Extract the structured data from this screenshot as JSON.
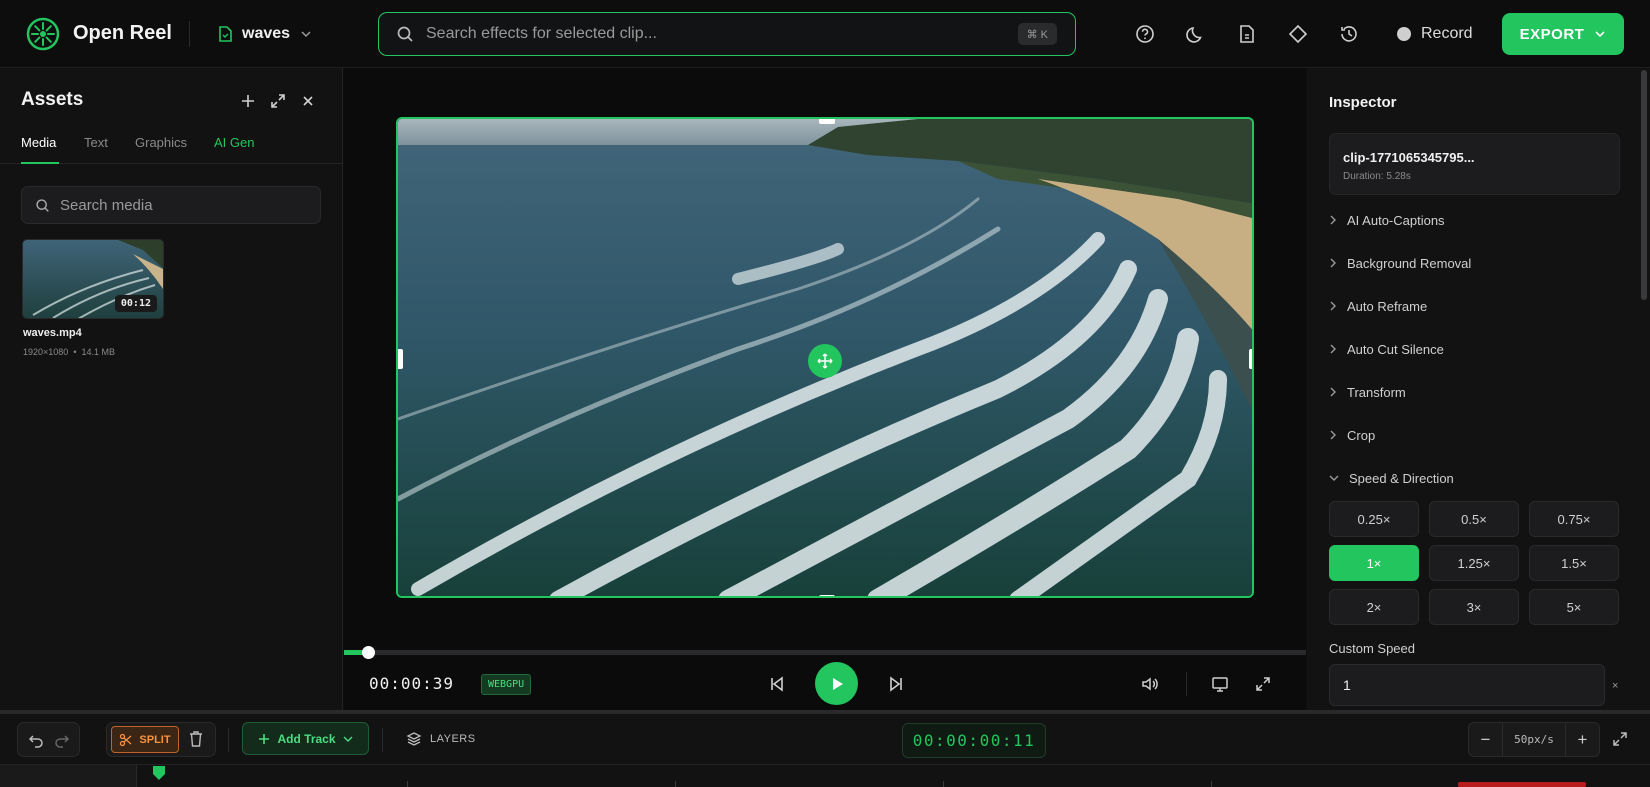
{
  "topbar": {
    "app_title": "Open Reel",
    "project_name": "waves",
    "search_placeholder": "Search effects for selected clip...",
    "search_shortcut": "⌘ K",
    "record_label": "Record",
    "export_label": "EXPORT",
    "icons": [
      "help-icon",
      "moon-icon",
      "document-icon",
      "diamond-icon",
      "history-icon"
    ]
  },
  "assets": {
    "title": "Assets",
    "tabs": [
      "Media",
      "Text",
      "Graphics",
      "AI Gen"
    ],
    "active_tab": "Media",
    "search_placeholder": "Search media",
    "media": [
      {
        "filename": "waves.mp4",
        "duration": "00:12",
        "resolution": "1920×1080",
        "size": "14.1 MB",
        "separator": "•"
      }
    ]
  },
  "preview": {
    "current_time": "00:00:39",
    "renderer_badge": "WEBGPU",
    "progress_fraction": 0.025
  },
  "inspector": {
    "title": "Inspector",
    "clip_name": "clip-1771065345795...",
    "clip_duration": "Duration: 5.28s",
    "sections": [
      "AI Auto-Captions",
      "Background Removal",
      "Auto Reframe",
      "Auto Cut Silence",
      "Transform",
      "Crop"
    ],
    "expanded_section": "Speed & Direction",
    "speed_options": [
      "0.25×",
      "0.5×",
      "0.75×",
      "1×",
      "1.25×",
      "1.5×",
      "2×",
      "3×",
      "5×"
    ],
    "selected_speed": "1×",
    "custom_speed_label": "Custom Speed",
    "custom_speed_value": "1",
    "custom_speed_unit": "×"
  },
  "timeline": {
    "split_label": "SPLIT",
    "add_track_label": "Add Track",
    "layers_label": "LAYERS",
    "timecode": "00:00:00:11",
    "zoom_value": "50px/s",
    "zoom_minus": "−",
    "zoom_plus": "+"
  },
  "colors": {
    "accent": "#22c55e",
    "split": "#fb923c",
    "background": "#0d0d0e",
    "panel": "#121213"
  }
}
